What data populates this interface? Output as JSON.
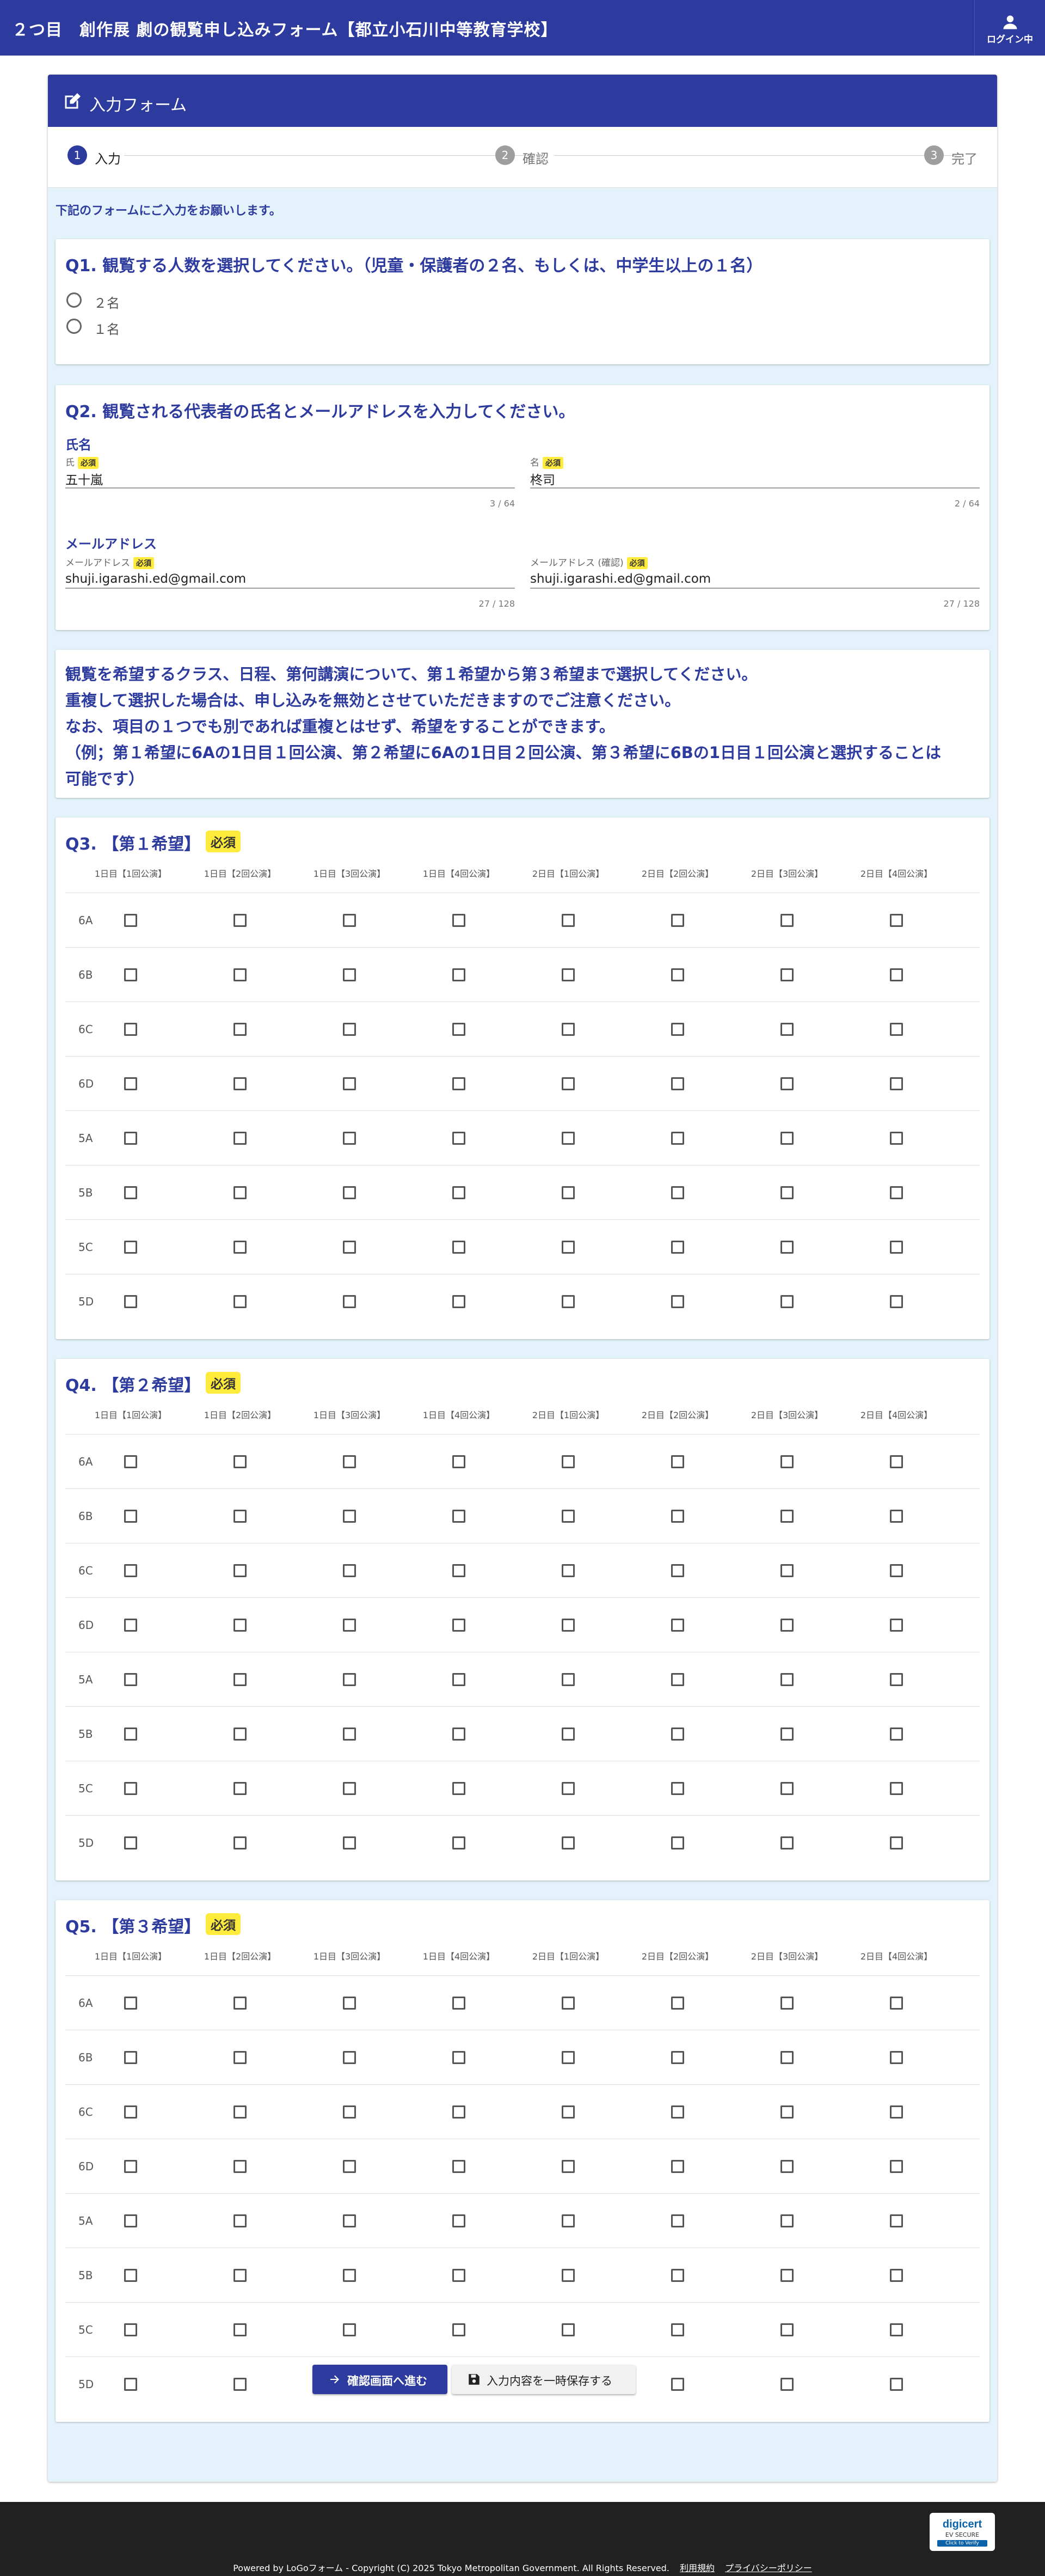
{
  "header": {
    "title": "２つ目　創作展 劇の観覧申し込みフォーム【都立小石川中等教育学校】",
    "login_label": "ログイン中"
  },
  "form": {
    "title": "入力フォーム",
    "steps": [
      {
        "num": "1",
        "label": "入力",
        "active": true
      },
      {
        "num": "2",
        "label": "確認",
        "active": false
      },
      {
        "num": "3",
        "label": "完了",
        "active": false
      }
    ],
    "notice": "下記のフォームにご入力をお願いします。"
  },
  "q1": {
    "title": "Q1. 観覧する人数を選択してください。（児童・保護者の２名、もしくは、中学生以上の１名）",
    "options": [
      "２名",
      "１名"
    ]
  },
  "q2": {
    "title": "Q2. 観覧される代表者の氏名とメールアドレスを入力してください。",
    "name_label": "氏名",
    "email_label": "メールアドレス",
    "required": "必須",
    "fields": {
      "last_name": {
        "label": "氏",
        "value": "五十嵐",
        "count": "3 / 64"
      },
      "first_name": {
        "label": "名",
        "value": "柊司",
        "count": "2 / 64"
      },
      "email": {
        "label": "メールアドレス",
        "value": "shuji.igarashi.ed@gmail.com",
        "count": "27 / 128"
      },
      "email_confirm": {
        "label": "メールアドレス (確認)",
        "value": "shuji.igarashi.ed@gmail.com",
        "count": "27 / 128"
      }
    }
  },
  "info": {
    "lines": [
      "観覧を希望するクラス、日程、第何講演について、第１希望から第３希望まで選択してください。",
      "重複して選択した場合は、申し込みを無効とさせていただきますのでご注意ください。",
      "なお、項目の１つでも別であれば重複とはせず、希望をすることができます。",
      "（例；第１希望に6Aの1日目１回公演、第２希望に6Aの1日目２回公演、第３希望に6Bの1日目１回公演と選択することは",
      "可能です）"
    ]
  },
  "grid": {
    "columns": [
      "1日目【1回公演】",
      "1日目【2回公演】",
      "1日目【3回公演】",
      "1日目【4回公演】",
      "2日目【1回公演】",
      "2日目【2回公演】",
      "2日目【3回公演】",
      "2日目【4回公演】"
    ],
    "rows": [
      "6A",
      "6B",
      "6C",
      "6D",
      "5A",
      "5B",
      "5C",
      "5D"
    ],
    "required": "必須"
  },
  "q3": {
    "title": "Q3. 【第１希望】"
  },
  "q4": {
    "title": "Q4. 【第２希望】"
  },
  "q5": {
    "title": "Q5. 【第３希望】"
  },
  "buttons": {
    "confirm": "確認画面へ進む",
    "save": "入力内容を一時保存する"
  },
  "footer": {
    "copyright": "Powered by LoGoフォーム - Copyright (C) 2025 Tokyo Metropolitan Government. All Rights Reserved.",
    "terms": "利用規約",
    "privacy": "プライバシーポリシー",
    "badge_title": "digicert",
    "badge_sub": "EV SECURE",
    "badge_bottom": "Click to Verify"
  },
  "colors": {
    "primary": "#2e3b9e",
    "background": "#e3f2fb",
    "required": "#ffeb3b"
  }
}
